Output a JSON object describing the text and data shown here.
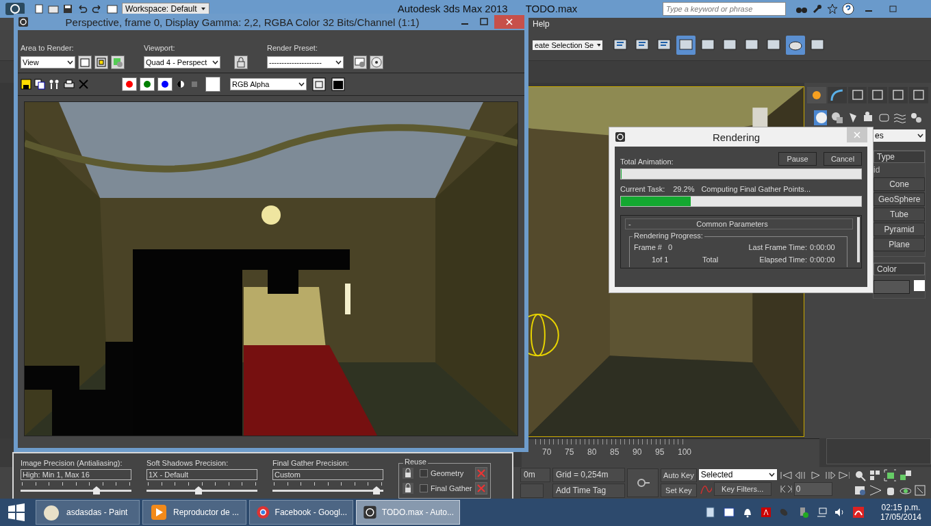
{
  "app": {
    "title": "Autodesk 3ds Max  2013",
    "file": "TODO.max",
    "workspace": "Workspace: Default",
    "search": {
      "placeholder": "Type a keyword or phrase"
    },
    "menu": [
      "Help"
    ],
    "selection_set": "eate Selection Se"
  },
  "render_window": {
    "title": "Perspective, frame 0, Display Gamma: 2,2, RGBA Color 32 Bits/Channel (1:1)",
    "area": {
      "label": "Area to Render:",
      "value": "View"
    },
    "viewport": {
      "label": "Viewport:",
      "value": "Quad 4 - Perspect"
    },
    "preset": {
      "label": "Render Preset:",
      "value": "---------------------"
    },
    "channels": [
      {
        "color": "#ff0000"
      },
      {
        "color": "#008000"
      },
      {
        "color": "#0000ff"
      }
    ],
    "display_channel": "RGB Alpha"
  },
  "render_settings": {
    "precisions": [
      {
        "label": "Image Precision (Antialiasing):",
        "value": "High: Min 1, Max 16",
        "level": 0.73
      },
      {
        "label": "Soft Shadows Precision:",
        "value": "1X - Default",
        "level": 0.5
      },
      {
        "label": "Final Gather Precision:",
        "value": "Custom",
        "level": 1.0
      }
    ],
    "reuse": {
      "title": "Reuse",
      "options": [
        {
          "label": "Geometry",
          "checked": false
        },
        {
          "label": "Final Gather",
          "checked": false
        }
      ]
    }
  },
  "rendering_dialog": {
    "title": "Rendering",
    "buttons": [
      "Pause",
      "Cancel"
    ],
    "total": {
      "label": "Total Animation:",
      "level": 0
    },
    "task": {
      "label": "Current Task:",
      "percent": "29.2%",
      "text": "Computing Final Gather Points...",
      "level": 0.29
    },
    "section": {
      "toggle": "-",
      "title": "Common Parameters"
    },
    "group": {
      "title": "Rendering Progress:",
      "frame_label": "Frame #",
      "frame_value": "0",
      "frame_count": "1of 1",
      "total": "Total",
      "last_label": "Last Frame Time:",
      "last_value": "0:00:00",
      "elapsed_label": "Elapsed Time:",
      "elapsed_value": "0:00:00"
    }
  },
  "command_panel": {
    "dropdown": "es",
    "rollouts": [
      {
        "title": "Type",
        "note": "id",
        "buttons": [
          "Cone",
          "GeoSphere",
          "Tube",
          "Pyramid",
          "Plane"
        ]
      },
      {
        "title": "Color"
      }
    ]
  },
  "timeline": {
    "ticks": [
      "70",
      "75",
      "80",
      "85",
      "90",
      "95",
      "100"
    ]
  },
  "controls": {
    "coordinate": "0m",
    "grid": "Grid = 0,254m",
    "time_tag": "Add Time Tag",
    "auto_key": "Auto Key",
    "set_key": "Set Key",
    "key_mode": "Selected",
    "key_filters": "Key Filters...",
    "frame": "0"
  },
  "taskbar": {
    "items": [
      {
        "label": "asdasdas - Paint",
        "selected": false
      },
      {
        "label": "Reproductor de ...",
        "selected": false
      },
      {
        "label": "Facebook - Googl...",
        "selected": false
      },
      {
        "label": "TODO.max - Auto...",
        "selected": true
      }
    ],
    "time": "02:15 p.m.",
    "date": "17/05/2014"
  }
}
